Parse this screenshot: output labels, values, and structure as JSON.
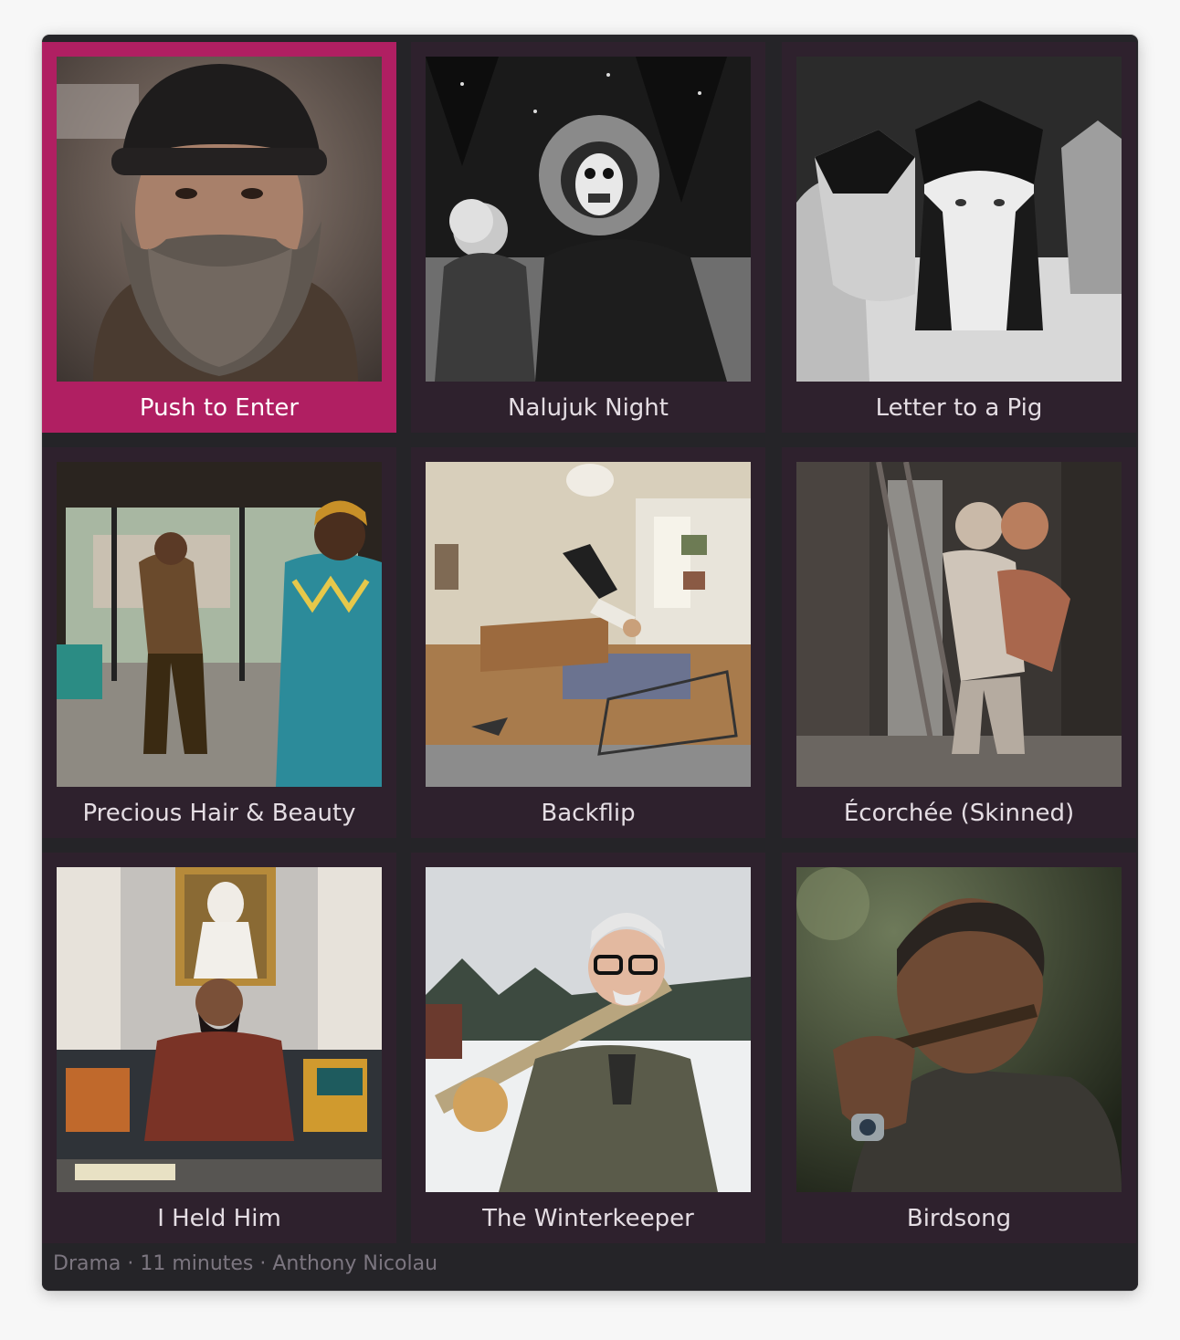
{
  "films": [
    {
      "title": "Push to Enter",
      "selected": true
    },
    {
      "title": "Nalujuk Night",
      "selected": false
    },
    {
      "title": "Letter to a Pig",
      "selected": false
    },
    {
      "title": "Precious Hair & Beauty",
      "selected": false
    },
    {
      "title": "Backflip",
      "selected": false
    },
    {
      "title": "Écorchée (Skinned)",
      "selected": false
    },
    {
      "title": "I Held Him",
      "selected": false
    },
    {
      "title": "The Winterkeeper",
      "selected": false
    },
    {
      "title": "Birdsong",
      "selected": false
    }
  ],
  "status_bar": {
    "text": "Drama · 11 minutes · Anthony Nicolau"
  },
  "colors": {
    "selected_accent": "#b01f62",
    "tile_background": "#2e212d",
    "window_background": "#252428"
  }
}
